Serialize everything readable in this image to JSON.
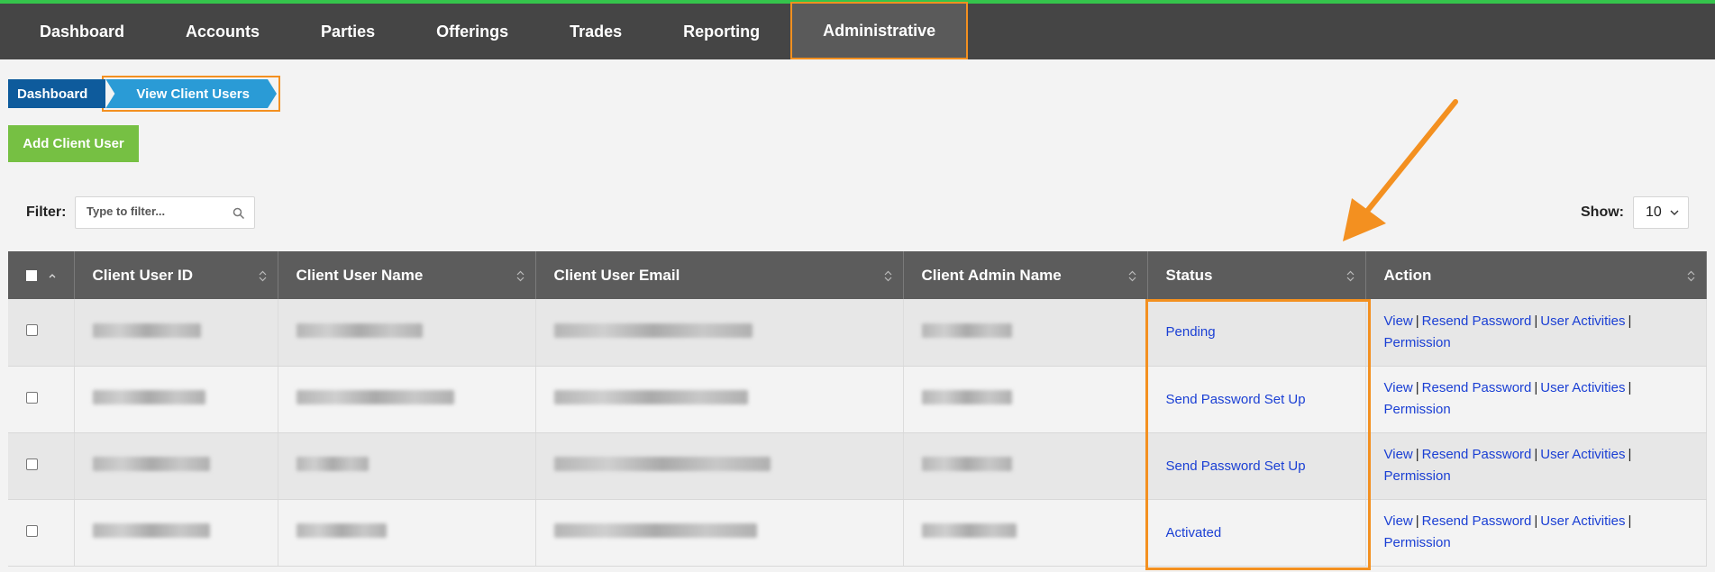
{
  "nav": {
    "items": [
      "Dashboard",
      "Accounts",
      "Parties",
      "Offerings",
      "Trades",
      "Reporting",
      "Administrative"
    ],
    "active": "Administrative"
  },
  "breadcrumb": {
    "home": "Dashboard",
    "current": "View Client Users"
  },
  "add_button": "Add Client User",
  "filter": {
    "label": "Filter:",
    "placeholder": "Type to filter..."
  },
  "show": {
    "label": "Show:",
    "value": "10"
  },
  "table": {
    "columns": [
      "Client User ID",
      "Client User Name",
      "Client User Email",
      "Client Admin Name",
      "Status",
      "Action"
    ],
    "rows": [
      {
        "status": "Pending"
      },
      {
        "status": "Send Password Set Up"
      },
      {
        "status": "Send Password Set Up"
      },
      {
        "status": "Activated"
      }
    ],
    "actions": {
      "view": "View",
      "resend": "Resend Password",
      "activities": "User Activities",
      "permission": "Permission",
      "separator": "|"
    }
  },
  "colors": {
    "nav_bg": "#454545",
    "accent_green": "#35c44c",
    "highlight_orange": "#f39020",
    "button_green": "#76c043",
    "link_blue": "#1a3fd4",
    "breadcrumb_home": "#0e5b9c",
    "breadcrumb_current": "#2a9bd6"
  }
}
